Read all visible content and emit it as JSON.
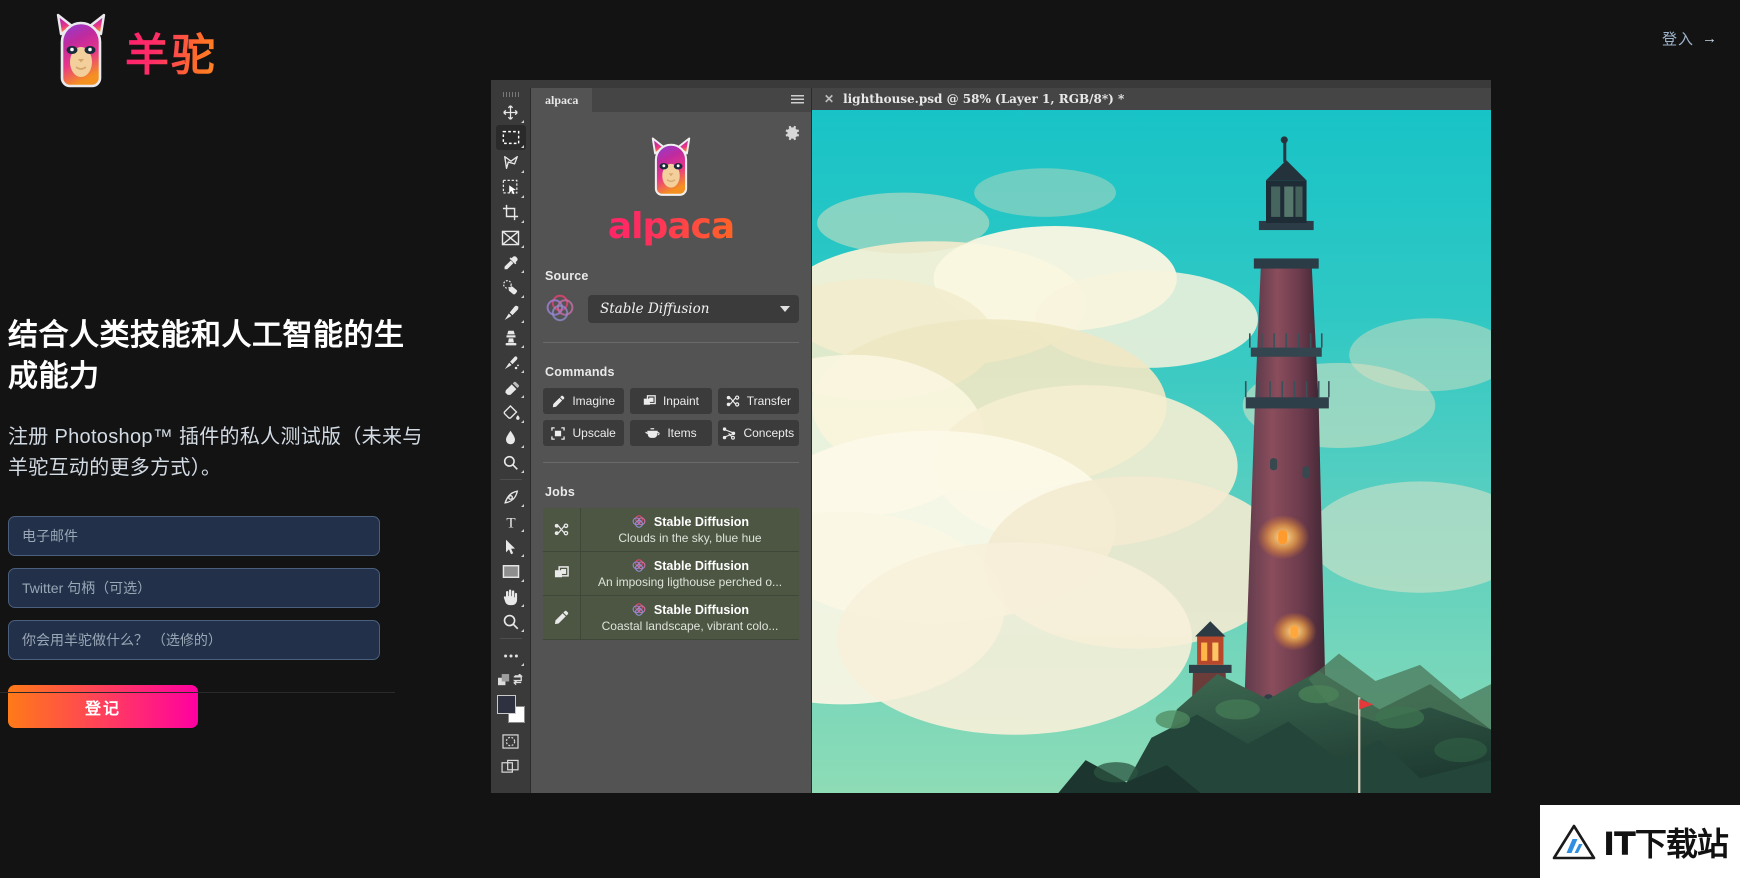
{
  "brand": {
    "title": "羊驼",
    "logo_icon": "alpaca-logo-icon"
  },
  "header": {
    "login_label": "登入",
    "login_arrow": "→"
  },
  "marketing": {
    "headline": "结合人类技能和人工智能的生成能力",
    "subcopy": "注册 Photoshop™ 插件的私人测试版（未来与羊驼互动的更多方式）。"
  },
  "form": {
    "email_placeholder": "电子邮件",
    "email_value": "",
    "twitter_placeholder": "Twitter 句柄（可选）",
    "twitter_value": "",
    "usecase_placeholder": "你会用羊驼做什么？ （选修的）",
    "usecase_value": "",
    "submit_label": "登记"
  },
  "photoshop": {
    "toolbar": {
      "tools": [
        {
          "name": "move-tool",
          "selected": false
        },
        {
          "name": "rectangular-marquee-tool",
          "selected": true
        },
        {
          "name": "lasso-tool",
          "selected": false
        },
        {
          "name": "object-selection-tool",
          "selected": false
        },
        {
          "name": "crop-tool",
          "selected": false
        },
        {
          "name": "frame-tool",
          "selected": false
        },
        {
          "name": "eyedropper-tool",
          "selected": false
        },
        {
          "name": "spot-healing-brush-tool",
          "selected": false
        },
        {
          "name": "brush-tool",
          "selected": false
        },
        {
          "name": "clone-stamp-tool",
          "selected": false
        },
        {
          "name": "history-brush-tool",
          "selected": false
        },
        {
          "name": "eraser-tool",
          "selected": false
        },
        {
          "name": "gradient-tool",
          "selected": false
        },
        {
          "name": "blur-tool",
          "selected": false
        },
        {
          "name": "dodge-tool",
          "selected": false
        },
        {
          "name": "pen-tool",
          "selected": false
        },
        {
          "name": "type-tool",
          "selected": false
        },
        {
          "name": "path-selection-tool",
          "selected": false
        },
        {
          "name": "rectangle-tool",
          "selected": false
        },
        {
          "name": "hand-tool",
          "selected": false
        },
        {
          "name": "zoom-tool",
          "selected": false
        },
        {
          "name": "edit-toolbar-tool",
          "selected": false
        }
      ]
    },
    "panel": {
      "tab_label": "alpaca",
      "wordmark": "alpaca",
      "gear_icon": "gear-icon",
      "menu_icon": "panel-menu-icon",
      "source": {
        "label": "Source",
        "badge_icon": "stable-diffusion-icon",
        "selected": "Stable Diffusion"
      },
      "commands": {
        "label": "Commands",
        "items": [
          {
            "label": "Imagine",
            "icon": "pencil-icon"
          },
          {
            "label": "Inpaint",
            "icon": "layers-icon"
          },
          {
            "label": "Transfer",
            "icon": "shuffle-icon"
          },
          {
            "label": "Upscale",
            "icon": "expand-frame-icon"
          },
          {
            "label": "Items",
            "icon": "teapot-icon"
          },
          {
            "label": "Concepts",
            "icon": "molecule-icon"
          }
        ]
      },
      "jobs": {
        "label": "Jobs",
        "items": [
          {
            "icon": "shuffle-icon",
            "source": "Stable Diffusion",
            "prompt": "Clouds in the sky, blue hue"
          },
          {
            "icon": "layers-icon",
            "source": "Stable Diffusion",
            "prompt": "An imposing ligthouse perched o..."
          },
          {
            "icon": "pencil-icon",
            "source": "Stable Diffusion",
            "prompt": "Coastal landscape, vibrant colo..."
          }
        ]
      }
    },
    "document": {
      "close_icon": "close-icon",
      "tab_label": "lighthouse.psd @ 58% (Layer 1, RGB/8*) *"
    }
  },
  "watermark": {
    "text": "IT下载站",
    "icon": "triangle-logo-icon"
  },
  "colors": {
    "accent_pink": "#ff1478",
    "accent_orange": "#ff7d0d",
    "field_bg": "#22304a",
    "panel_bg": "#535353",
    "job_bg": "#4c5643"
  }
}
